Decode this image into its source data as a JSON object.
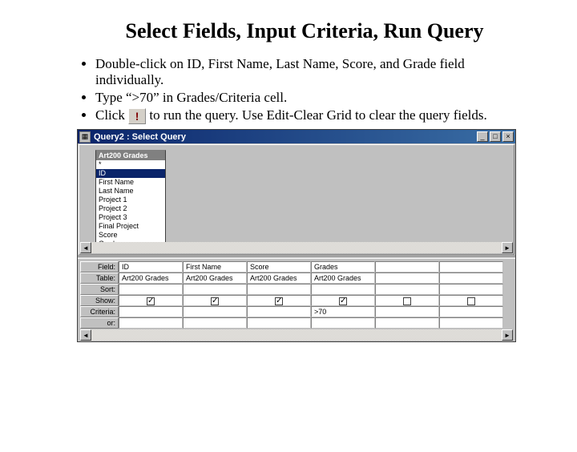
{
  "title": "Select Fields, Input Criteria, Run Query",
  "instructions": [
    "Double-click on ID, First Name, Last Name, Score, and Grade field individually.",
    "Type “>70” in Grades/Criteria cell.",
    "Click __ICON__ to run the query.  Use Edit-Clear Grid to clear the query fields."
  ],
  "run_icon_glyph": "!",
  "window": {
    "title": "Query2 : Select Query",
    "buttons": {
      "min": "_",
      "max": "□",
      "close": "×"
    }
  },
  "field_list": {
    "caption": "Art200 Grades",
    "items": [
      "*",
      "ID",
      "First Name",
      "Last Name",
      "Project 1",
      "Project 2",
      "Project 3",
      "Final Project",
      "Score",
      "Grades"
    ],
    "selected": "ID"
  },
  "design_grid": {
    "row_labels": [
      "Field:",
      "Table:",
      "Sort:",
      "Show:",
      "Criteria:",
      "or:"
    ],
    "columns": [
      {
        "field": "ID",
        "table": "Art200 Grades",
        "sort": "",
        "show": true,
        "criteria": "",
        "or": ""
      },
      {
        "field": "First Name",
        "table": "Art200 Grades",
        "sort": "",
        "show": true,
        "criteria": "",
        "or": ""
      },
      {
        "field": "Score",
        "table": "Art200 Grades",
        "sort": "",
        "show": true,
        "criteria": "",
        "or": ""
      },
      {
        "field": "Grades",
        "table": "Art200 Grades",
        "sort": "",
        "show": true,
        "criteria": ">70",
        "or": ""
      },
      {
        "field": "",
        "table": "",
        "sort": "",
        "show": false,
        "criteria": "",
        "or": ""
      },
      {
        "field": "",
        "table": "",
        "sort": "",
        "show": false,
        "criteria": "",
        "or": ""
      }
    ]
  }
}
